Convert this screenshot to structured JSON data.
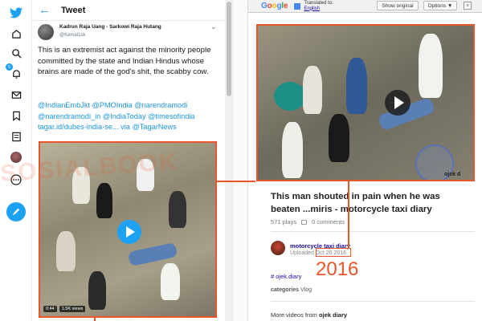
{
  "twitter": {
    "header": {
      "title": "Tweet"
    },
    "author": {
      "name": "Kadrun Raja Uang - Sarkowi Raja Hutang",
      "handle": "@Kemal1sk"
    },
    "text": "This is an extremist act against the minority people committed by the state and Indian Hindus whose brains are made of the god's shit, the scabby cow.",
    "links": "@IndianEmbJkt @PMOIndia @narendramodi @narendramodi_in @IndiaToday @timesofindia tagar.id/dubes-india-se... via @TagarNews",
    "video": {
      "duration": "0:44",
      "views": "1.5K views"
    },
    "rail_icons": [
      "twitter-logo",
      "home-icon",
      "explore-icon",
      "notifications-icon",
      "messages-icon",
      "bookmarks-icon",
      "lists-icon",
      "profile-icon",
      "more-icon",
      "compose-icon"
    ],
    "notification_count": "5",
    "watermark": "SOSIALBOOK",
    "colors": {
      "accent": "#1da1f2",
      "highlight": "#e8562a"
    }
  },
  "translate_bar": {
    "logo": "Google",
    "translated_to_label": "Translated to:",
    "language": "English",
    "show_original": "Show original",
    "options": "Options ▼",
    "close": "×"
  },
  "video_page": {
    "title": "This man shouted in pain when he was beaten ...miris - motorcycle taxi diary",
    "plays": "571 plays",
    "comments": "0 comments",
    "channel": "motorcycle taxi diary",
    "uploaded_label": "Uploaded",
    "date": "Oct 26 2016",
    "tag": "# ojek.diary",
    "categories_label": "categories",
    "category": "Vlog",
    "more_videos_label": "More videos from",
    "more_videos_channel": "ojek diary",
    "video_watermark": "ojek d"
  },
  "annotation": {
    "year": "2016"
  }
}
